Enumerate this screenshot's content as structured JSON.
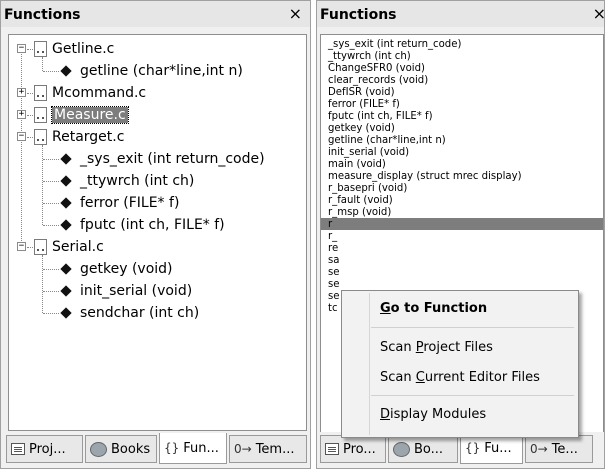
{
  "left_panel": {
    "title": "Functions",
    "close": "×",
    "tree": [
      {
        "file": "Getline.c",
        "expanded": true,
        "functions": [
          "getline (char*line,int n)"
        ]
      },
      {
        "file": "Mcommand.c",
        "expanded": false,
        "functions": []
      },
      {
        "file": "Measure.c",
        "expanded": false,
        "selected": true,
        "functions": []
      },
      {
        "file": "Retarget.c",
        "expanded": true,
        "functions": [
          "_sys_exit (int return_code)",
          "_ttywrch (int ch)",
          "ferror (FILE* f)",
          "fputc (int ch, FILE* f)"
        ]
      },
      {
        "file": "Serial.c",
        "expanded": true,
        "functions": [
          "getkey (void)",
          "init_serial (void)",
          "sendchar (int ch)"
        ]
      }
    ],
    "tabs": [
      "Proj...",
      "Books",
      "Fun...",
      "Tem..."
    ],
    "tab_icons": [
      "project-icon",
      "books-icon",
      "functions-icon",
      "templates-icon"
    ],
    "active_tab": 2
  },
  "right_panel": {
    "title": "Functions",
    "close": "×",
    "functions": [
      "_sys_exit (int return_code)",
      "_ttywrch (int ch)",
      "ChangeSFR0 (void)",
      "clear_records (void)",
      "DefISR (void)",
      "ferror (FILE* f)",
      "fputc (int ch, FILE* f)",
      "getkey (void)",
      "getline (char*line,int n)",
      "init_serial (void)",
      "main (void)",
      "measure_display (struct mrec display)",
      "r_basepri (void)",
      "r_fault (void)",
      "r_msp (void)",
      "r",
      "r_",
      "re",
      "sa",
      "se",
      "se",
      "se",
      "tc"
    ],
    "selected_index": 15,
    "tabs": [
      "Pro...",
      "Bo...",
      "Fu...",
      "Te..."
    ],
    "active_tab": 2
  },
  "context_menu": {
    "items": [
      {
        "pre": "",
        "u": "G",
        "post": "o to Function",
        "bold": true
      },
      {
        "pre": "Scan ",
        "u": "P",
        "post": "roject Files",
        "bold": false
      },
      {
        "pre": "Scan ",
        "u": "C",
        "post": "urrent Editor Files",
        "bold": false
      },
      {
        "pre": "",
        "u": "D",
        "post": "isplay Modules",
        "bold": false
      }
    ]
  },
  "tab_glyphs": {
    "functions": "{}",
    "templates": "0→"
  }
}
